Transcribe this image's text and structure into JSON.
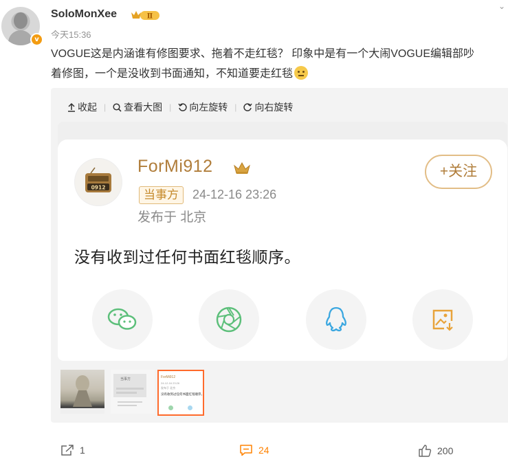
{
  "post": {
    "username": "SoloMonXee",
    "level_badge": "Ⅱ",
    "verified_badge": "v",
    "time": "今天15:36",
    "line1": "VOGUE这是内涵谁有修图要求、拖着不走红毯？ 印象中是有一个大闹VOGUE编辑部吵",
    "line2": "着修图，一个是没收到书面通知，不知道要走红毯",
    "emoji": "emoji-smile-icon"
  },
  "toolbar": {
    "collapse": "收起",
    "view_large": "查看大图",
    "rotate_left": "向左旋转",
    "rotate_right": "向右旋转"
  },
  "image": {
    "account_name": "ForMi912",
    "avatar_label": "0912",
    "tag": "当事方",
    "date": "24-12-16 23:26",
    "location": "发布于 北京",
    "follow": "+关注",
    "text": "没有收到过任何书面红毯顺序。",
    "share_icons": [
      "wechat-icon",
      "moments-icon",
      "qq-icon",
      "save-image-icon"
    ]
  },
  "thumbnails": {
    "count": 3,
    "active_index": 2,
    "t2_line": "当事方",
    "t3_name": "ForMi912",
    "t3_date": "24-12-16 23:26",
    "t3_loc": "发布于 北京",
    "t3_text": "没有收到过任何书面红毯顺序。"
  },
  "footer": {
    "reposts": "1",
    "comments": "24",
    "likes": "200"
  },
  "colors": {
    "accent_orange": "#ff8200",
    "gold": "#b07d3a",
    "active_thumb_border": "#ff6a2b"
  }
}
